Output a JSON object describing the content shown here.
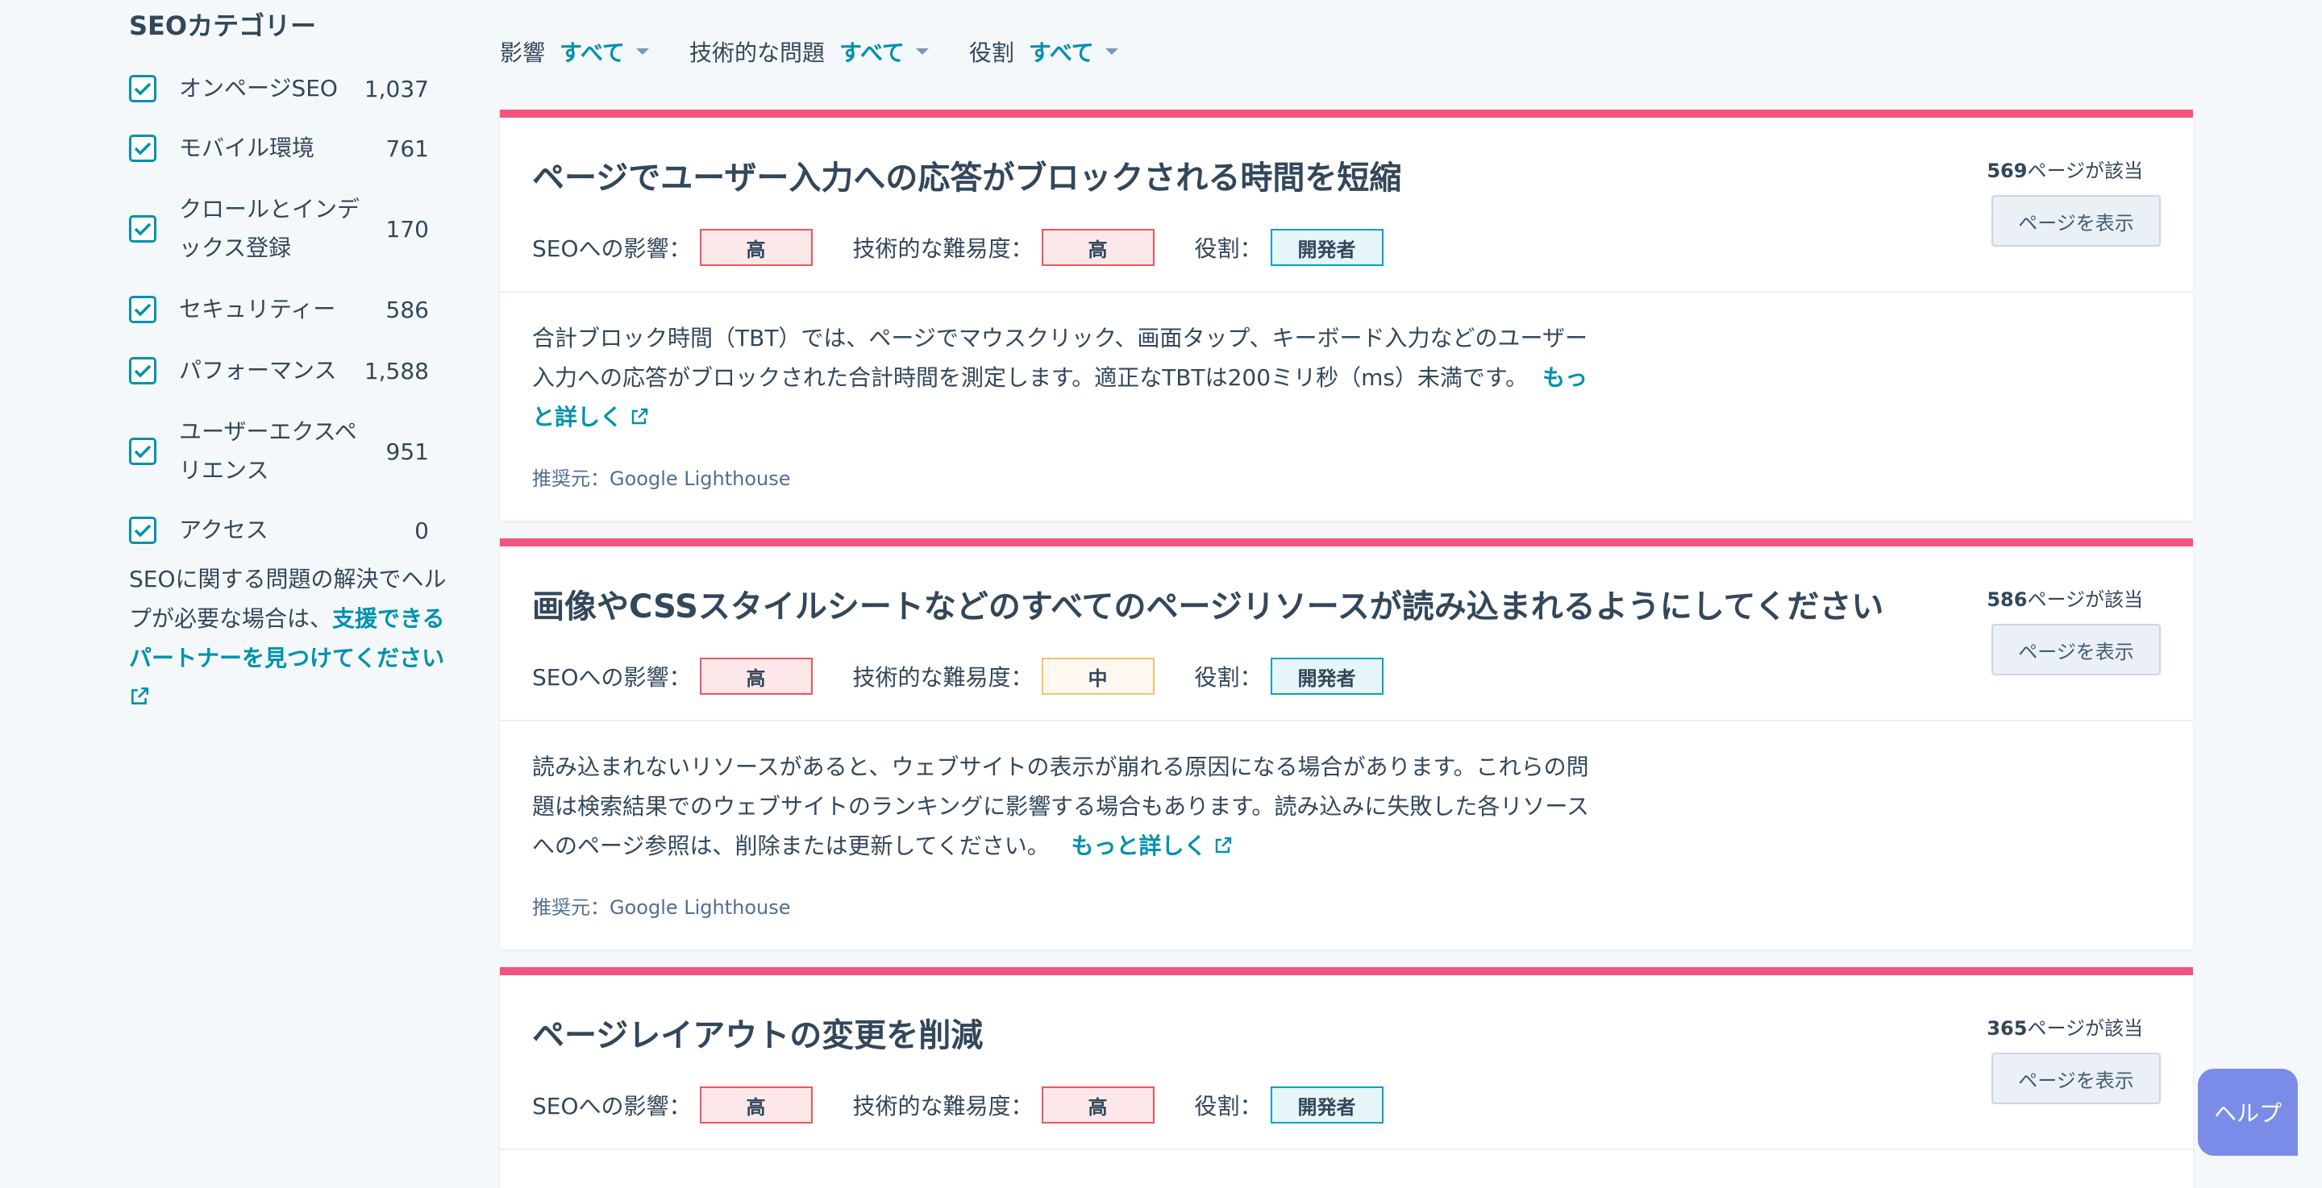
{
  "sidebar": {
    "title": "SEOカテゴリー",
    "categories": [
      {
        "label": "オンページSEO",
        "count": "1,037"
      },
      {
        "label": "モバイル環境",
        "count": "761"
      },
      {
        "label": "クロールとインデックス登録",
        "count": "170"
      },
      {
        "label": "セキュリティー",
        "count": "586"
      },
      {
        "label": "パフォーマンス",
        "count": "1,588"
      },
      {
        "label": "ユーザーエクスペリエンス",
        "count": "951"
      },
      {
        "label": "アクセス",
        "count": "0"
      }
    ],
    "help_text": "SEOに関する問題の解決でヘルプが必要な場合は、",
    "help_link": "支援できるパートナーを見つけてください"
  },
  "filters": [
    {
      "label": "影響",
      "value": "すべて"
    },
    {
      "label": "技術的な問題",
      "value": "すべて"
    },
    {
      "label": "役割",
      "value": "すべて"
    }
  ],
  "labels": {
    "impact": "SEOへの影響：",
    "difficulty": "技術的な難易度：",
    "role": "役割：",
    "pages_suffix": "ページが該当",
    "view_button": "ページを表示",
    "recommended_by": "推奨元：Google Lighthouse",
    "more": "もっと詳しく"
  },
  "cards": [
    {
      "title": "ページでユーザー入力への応答がブロックされる時間を短縮",
      "impact": "高",
      "difficulty": "高",
      "role": "開発者",
      "pages": "569",
      "desc": "合計ブロック時間（TBT）では、ページでマウスクリック、画面タップ、キーボード入力などのユーザー入力への応答がブロックされた合計時間を測定します。適正なTBTは200ミリ秒（ms）未満です。"
    },
    {
      "title": "画像やCSSスタイルシートなどのすべてのページリソースが読み込まれるようにしてください",
      "impact": "高",
      "difficulty": "中",
      "role": "開発者",
      "pages": "586",
      "desc": "読み込まれないリソースがあると、ウェブサイトの表示が崩れる原因になる場合があります。これらの問題は検索結果でのウェブサイトのランキングに影響する場合もあります。読み込みに失敗した各リソースへのページ参照は、削除または更新してください。"
    },
    {
      "title": "ページレイアウトの変更を削減",
      "impact": "高",
      "difficulty": "高",
      "role": "開発者",
      "pages": "365"
    }
  ],
  "help_button": "ヘルプ",
  "colors": {
    "accent": "#0091ae",
    "card_top": "#f2547d",
    "high": "#f2545b",
    "mid": "#f5c26b",
    "dev": "#00a4bd"
  }
}
